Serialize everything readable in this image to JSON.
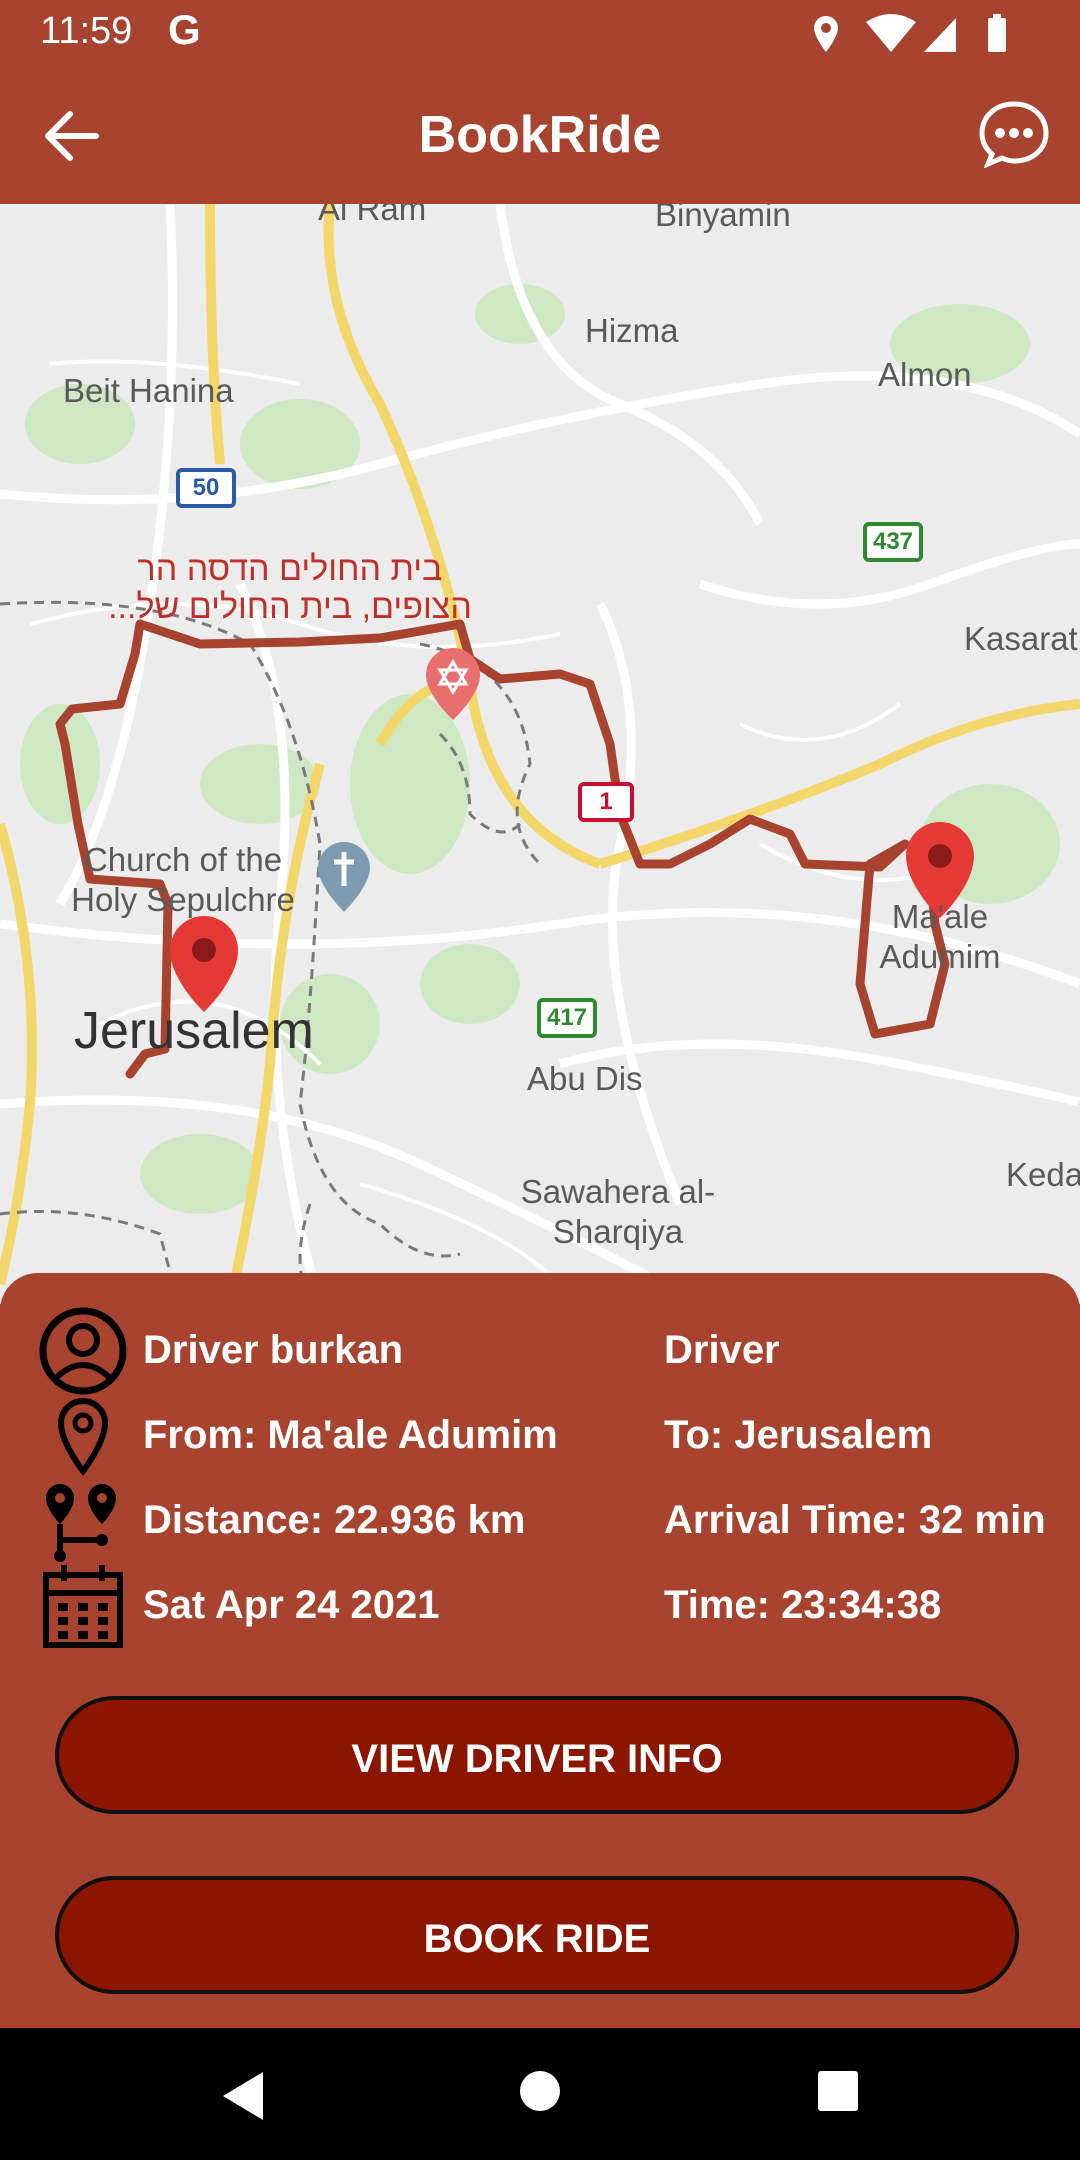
{
  "status_bar": {
    "time": "11:59",
    "g_label": "G"
  },
  "app_bar": {
    "title": "BookRide"
  },
  "map": {
    "labels": {
      "al_ram": "Al Ram",
      "binyamin": "Binyamin",
      "hizma": "Hizma",
      "almon": "Almon",
      "beit_hanina": "Beit Hanina",
      "kasarat": "Kasarat",
      "hospital": "בית החולים הדסה הר הצופים, בית החולים של...",
      "church": "Church of the Holy Sepulchre",
      "jerusalem": "Jerusalem",
      "maale_adumim": "Ma'ale Adumim",
      "abu_dis": "Abu Dis",
      "sawahera": "Sawahera al-Sharqiya",
      "keda": "Keda"
    },
    "shields": {
      "route_50": "50",
      "route_437": "437",
      "route_1": "1",
      "route_417": "417"
    }
  },
  "ride": {
    "driver_name": "Driver burkan",
    "role": "Driver",
    "from": "From: Ma'ale Adumim",
    "to": "To: Jerusalem",
    "distance": "Distance: 22.936 km",
    "arrival": "Arrival Time: 32 min",
    "date": "Sat Apr 24 2021",
    "time": "Time: 23:34:38"
  },
  "buttons": {
    "view_driver": "VIEW DRIVER INFO",
    "book_ride": "BOOK RIDE"
  },
  "colors": {
    "primary": "#a84330",
    "button": "#8c1500",
    "route": "#a84330",
    "marker": "#e53935"
  },
  "icons": {
    "back": "arrow-left-icon",
    "chat": "chat-bubble-icon",
    "avatar": "account-circle-icon",
    "location": "map-pin-icon",
    "distance": "route-icon",
    "calendar": "calendar-icon"
  }
}
